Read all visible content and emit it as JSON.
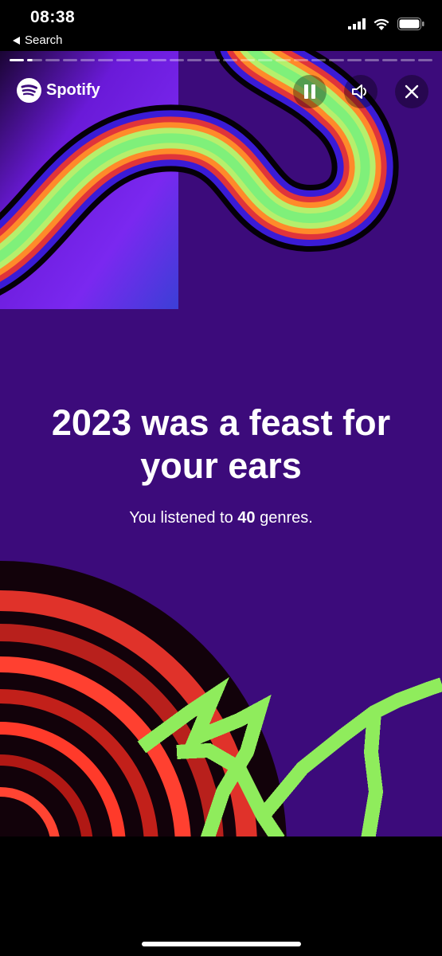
{
  "status_bar": {
    "time": "08:38",
    "back_label": "Search"
  },
  "brand": {
    "name": "Spotify"
  },
  "story": {
    "progress_segments_total": 24,
    "progress_current_index": 1,
    "headline_line1": "2023 was a feast for",
    "headline_line2": "your ears",
    "sub_prefix": "You listened to ",
    "sub_count": "40",
    "sub_suffix": " genres."
  },
  "controls": {
    "pause": "pause-icon",
    "volume": "speaker-icon",
    "close": "close-icon"
  },
  "colors": {
    "background": "#3c0b7b",
    "accent_green": "#8fec5c"
  }
}
